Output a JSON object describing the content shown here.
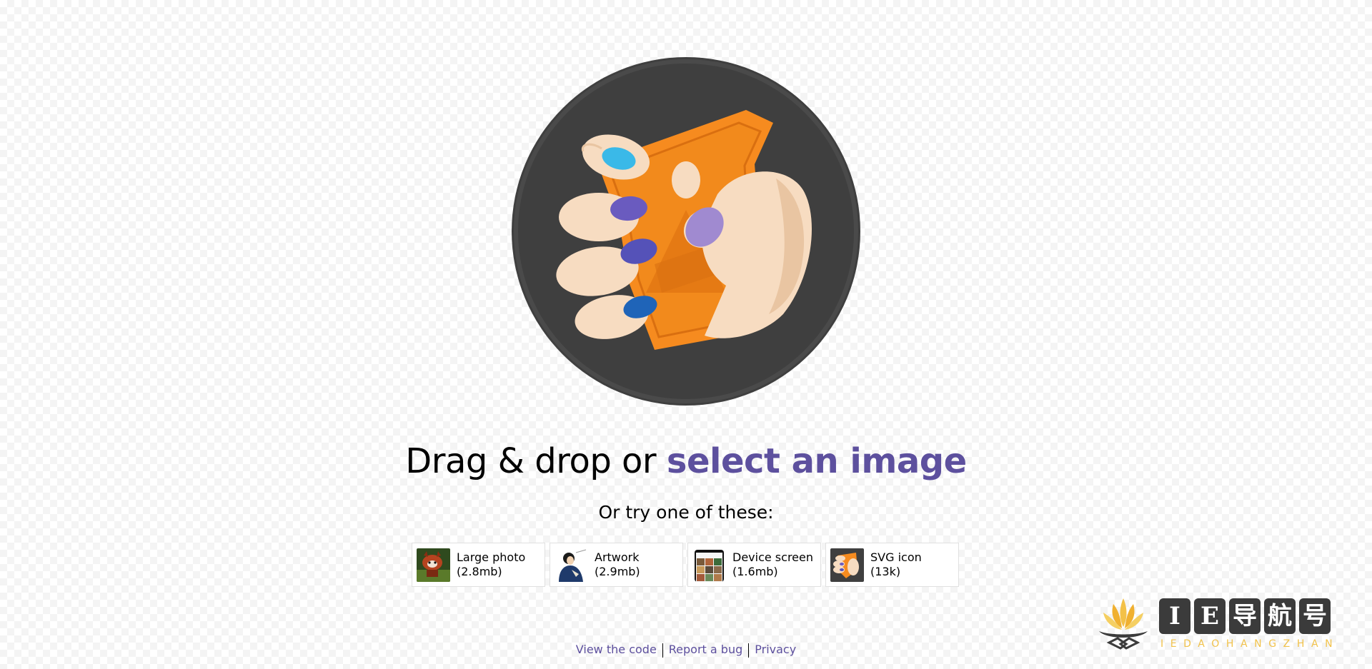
{
  "hero": {
    "logo_icon": "squoosh-hand-logo-icon"
  },
  "upload": {
    "prefix": "Drag & drop or ",
    "link_label": "select an image",
    "subtitle": "Or try one of these:"
  },
  "demos": [
    {
      "label": "Large photo",
      "size": "(2.8mb)",
      "icon": "red-panda-photo-thumbnail"
    },
    {
      "label": "Artwork",
      "size": "(2.9mb)",
      "icon": "artwork-thumbnail"
    },
    {
      "label": "Device screen",
      "size": "(1.6mb)",
      "icon": "device-screen-thumbnail"
    },
    {
      "label": "SVG icon",
      "size": "(13k)",
      "icon": "svg-icon-thumbnail"
    }
  ],
  "footer": {
    "links": [
      "View the code",
      "Report a bug",
      "Privacy"
    ]
  },
  "watermark": {
    "characters": [
      "I",
      "E",
      "导",
      "航",
      "号"
    ],
    "subtext": "IEDAOHANGZHAN"
  },
  "colors": {
    "link": "#5d509e",
    "logo_circle": "#3f3f3f",
    "logo_orange": "#f68b1f",
    "skin": "#f7dcc1",
    "watermark_gold": "#f1c24b"
  }
}
